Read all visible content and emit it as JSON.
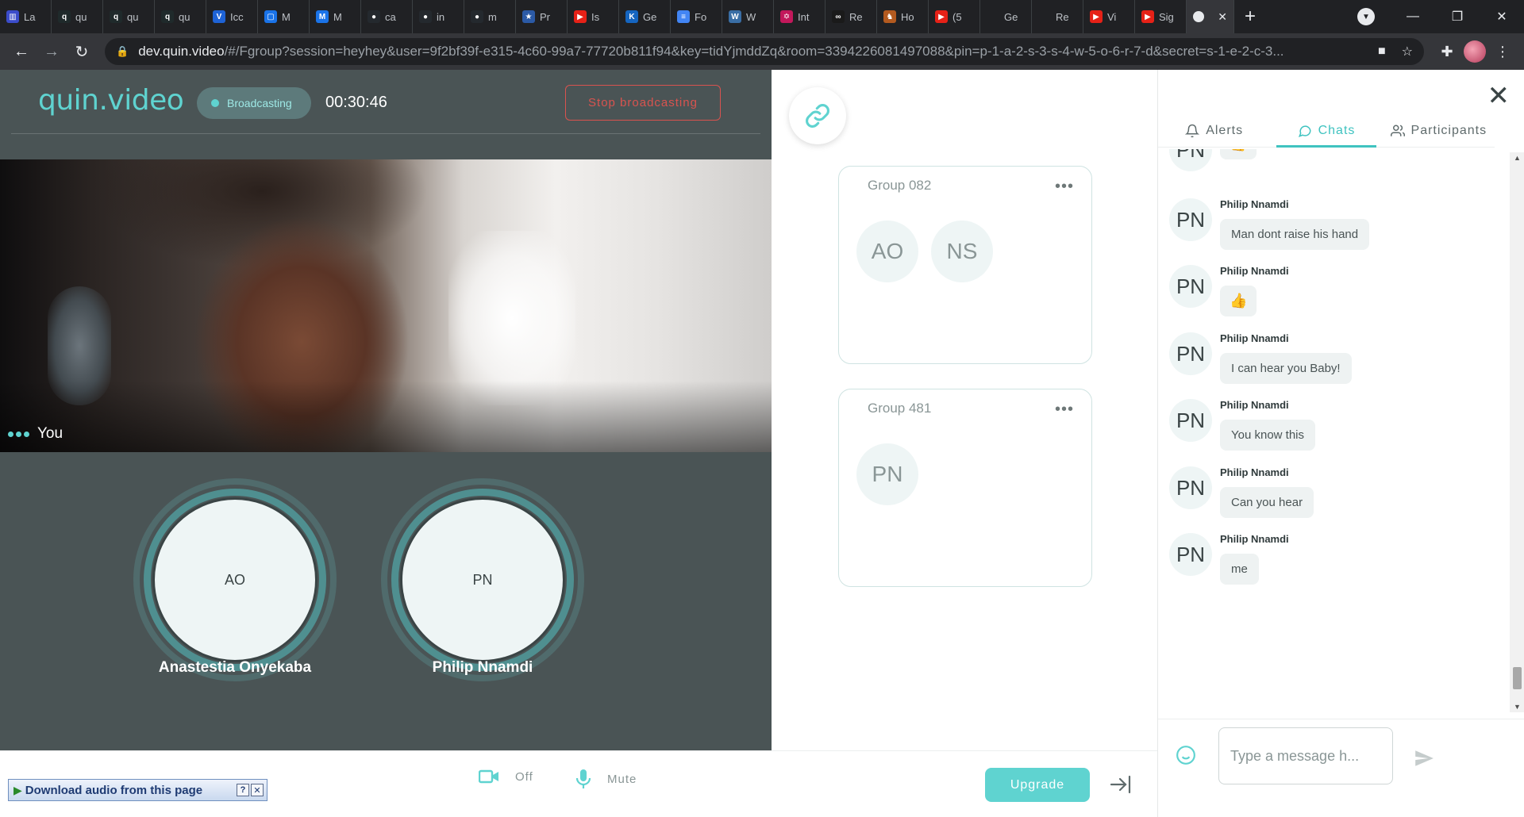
{
  "browser": {
    "tabs": [
      {
        "title": "La",
        "color": "#3b4cca",
        "glyph": "▥"
      },
      {
        "title": "qu",
        "color": "#1f2a2b",
        "glyph": "q"
      },
      {
        "title": "qu",
        "color": "#1f2a2b",
        "glyph": "q"
      },
      {
        "title": "qu",
        "color": "#1f2a2b",
        "glyph": "q"
      },
      {
        "title": "Icc",
        "color": "#1e63d6",
        "glyph": "V"
      },
      {
        "title": "M",
        "color": "#1a73e8",
        "glyph": "▢"
      },
      {
        "title": "M",
        "color": "#1a73e8",
        "glyph": "M"
      },
      {
        "title": "ca",
        "color": "#24292e",
        "glyph": "●"
      },
      {
        "title": "in",
        "color": "#24292e",
        "glyph": "●"
      },
      {
        "title": "m",
        "color": "#24292e",
        "glyph": "●"
      },
      {
        "title": "Pr",
        "color": "#2b5aa6",
        "glyph": "★"
      },
      {
        "title": "Is",
        "color": "#e62117",
        "glyph": "▶"
      },
      {
        "title": "Ge",
        "color": "#1565c0",
        "glyph": "K"
      },
      {
        "title": "Fo",
        "color": "#4285f4",
        "glyph": "≡"
      },
      {
        "title": "W",
        "color": "#3a6ea5",
        "glyph": "W"
      },
      {
        "title": "Int",
        "color": "#c2185b",
        "glyph": "✡"
      },
      {
        "title": "Re",
        "color": "#1a1a1a",
        "glyph": "∞"
      },
      {
        "title": "Ho",
        "color": "#b35a1f",
        "glyph": "♞"
      },
      {
        "title": "(5",
        "color": "#e62117",
        "glyph": "▶"
      },
      {
        "title": "Ge",
        "color": "#202124",
        "glyph": ""
      },
      {
        "title": "Re",
        "color": "#202124",
        "glyph": ""
      },
      {
        "title": "Vi",
        "color": "#e62117",
        "glyph": "▶"
      },
      {
        "title": "Sig",
        "color": "#e62117",
        "glyph": "▶"
      }
    ],
    "url_host": "dev.quin.video",
    "url_rest": "/#/Fgroup?session=heyhey&user=9f2bf39f-e315-4c60-99a7-77720b811f94&key=tidYjmddZq&room=3394226081497088&pin=p-1-a-2-s-3-s-4-w-5-o-6-r-7-d&secret=s-1-e-2-c-3..."
  },
  "header": {
    "brand": "quin.video",
    "status": "Broadcasting",
    "timer": "00:30:46",
    "stop_label": "Stop broadcasting"
  },
  "video": {
    "label": "You"
  },
  "participants": [
    {
      "initials": "AO",
      "name": "Anastestia Onyekaba"
    },
    {
      "initials": "PN",
      "name": "Philip Nnamdi"
    }
  ],
  "groups": [
    {
      "title": "Group 082",
      "members": [
        "AO",
        "NS"
      ]
    },
    {
      "title": "Group 481",
      "members": [
        "PN"
      ]
    }
  ],
  "panel": {
    "tabs": {
      "alerts": "Alerts",
      "chats": "Chats",
      "participants": "Participants"
    },
    "active_tab": "chats"
  },
  "chats": [
    {
      "initials": "PN",
      "sender": "",
      "text": "👍",
      "thumb": true
    },
    {
      "initials": "PN",
      "sender": "Philip Nnamdi",
      "text": "Man dont raise his hand"
    },
    {
      "initials": "PN",
      "sender": "Philip Nnamdi",
      "text": "👍",
      "thumb": true
    },
    {
      "initials": "PN",
      "sender": "Philip Nnamdi",
      "text": "I can hear you Baby!"
    },
    {
      "initials": "PN",
      "sender": "Philip Nnamdi",
      "text": "You know this"
    },
    {
      "initials": "PN",
      "sender": "Philip Nnamdi",
      "text": "Can you hear"
    },
    {
      "initials": "PN",
      "sender": "Philip Nnamdi",
      "text": "me"
    }
  ],
  "composer": {
    "placeholder": "Type a message h..."
  },
  "controls": {
    "camera_label": "Off",
    "mic_label": "Mute",
    "upgrade_label": "Upgrade"
  },
  "download_bar": {
    "label": "Download audio from this page"
  },
  "colors": {
    "accent": "#5fd3d0",
    "danger": "#d9534f",
    "stage": "#4a5455"
  }
}
